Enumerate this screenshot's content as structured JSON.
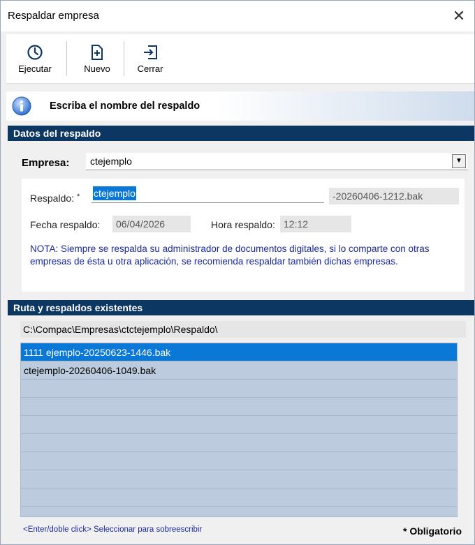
{
  "window": {
    "title": "Respaldar empresa",
    "close_glyph": "✕"
  },
  "toolbar": {
    "buttons": [
      {
        "label": "Ejecutar",
        "icon": "clock-icon"
      },
      {
        "label": "Nuevo",
        "icon": "new-document-icon"
      },
      {
        "label": "Cerrar",
        "icon": "exit-icon"
      }
    ]
  },
  "info": {
    "message": "Escriba el nombre del respaldo",
    "icon": "info-icon"
  },
  "datos": {
    "header": "Datos del respaldo",
    "empresa_label": "Empresa:",
    "empresa_value": "ctejemplo",
    "respaldo_label": "Respaldo:",
    "respaldo_required_mark": "*",
    "respaldo_value": "ctejemplo",
    "respaldo_suffix": "-20260406-1212.bak",
    "fecha_label": "Fecha respaldo:",
    "fecha_value": "06/04/2026",
    "hora_label": "Hora respaldo:",
    "hora_value": "12:12",
    "nota": "NOTA: Siempre se respalda su administrador de documentos digitales, si lo comparte con otras empresas de ésta u otra aplicación, se recomienda respaldar también dichas empresas."
  },
  "ruta": {
    "header": "Ruta y respaldos existentes",
    "path": "C:\\Compac\\Empresas\\ctctejemplo\\Respaldo\\",
    "files": [
      {
        "name": "1111 ejemplo-20250623-1446.bak",
        "selected": true
      },
      {
        "name": "ctejemplo-20260406-1049.bak",
        "selected": false
      }
    ],
    "empty_rows": 7
  },
  "footer": {
    "hint": "<Enter/doble click> Seleccionar para sobreescribir",
    "required": "* Obligatorio"
  },
  "colors": {
    "header_bg": "#0c3763",
    "selection": "#0a78d7",
    "list_bg": "#bccbdd",
    "nota_text": "#1a2a9c"
  }
}
